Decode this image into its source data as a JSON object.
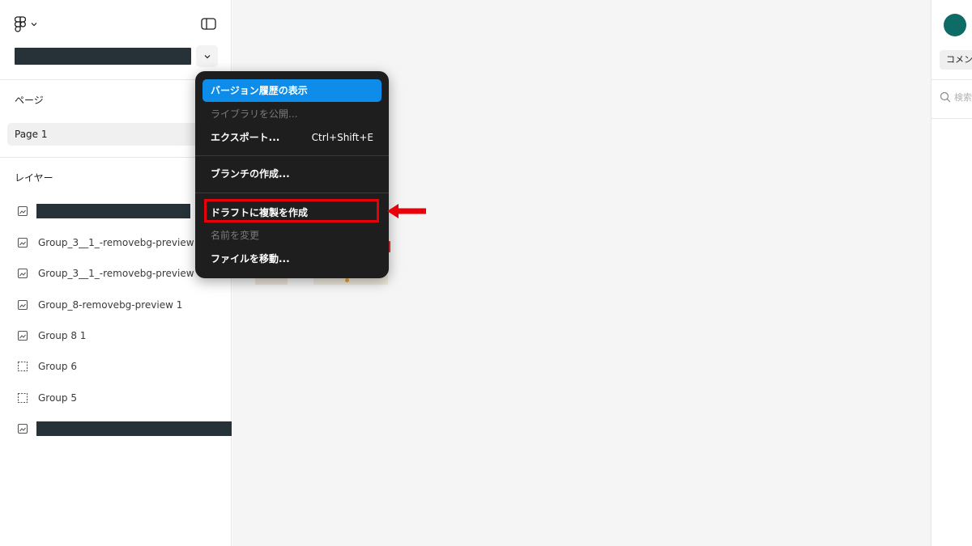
{
  "sidebar": {
    "pages_label": "ページ",
    "current_page": "Page 1",
    "layers_label": "レイヤー",
    "layers": [
      {
        "label": "Group_3__1_-removebg-preview",
        "icon": "image-frame-icon"
      },
      {
        "label": "Group_3__1_-removebg-preview",
        "icon": "image-frame-icon"
      },
      {
        "label": "Group_8-removebg-preview 1",
        "icon": "image-frame-icon"
      },
      {
        "label": "Group 8 1",
        "icon": "image-frame-icon"
      },
      {
        "label": "Group 6",
        "icon": "dashed-group-icon"
      },
      {
        "label": "Group 5",
        "icon": "dashed-group-icon"
      }
    ]
  },
  "right_panel": {
    "comment_tab_label": "コメント",
    "search_placeholder": "検索"
  },
  "context_menu": {
    "items": [
      {
        "label": "バージョン履歴の表示",
        "state": "active"
      },
      {
        "label": "ライブラリを公開...",
        "state": "disabled"
      },
      {
        "label": "エクスポート...",
        "shortcut": "Ctrl+Shift+E",
        "state": "normal"
      },
      {
        "label": "ブランチの作成...",
        "state": "normal"
      },
      {
        "label": "ドラフトに複製を作成",
        "state": "highlighted"
      },
      {
        "label": "名前を変更",
        "state": "disabled"
      },
      {
        "label": "ファイルを移動...",
        "state": "normal"
      }
    ]
  },
  "colors": {
    "menu_background": "#1e1e1e",
    "menu_active": "#0d8ce9",
    "annotation_red": "#e8000b",
    "avatar": "#0f6b65",
    "redaction": "#263238"
  }
}
